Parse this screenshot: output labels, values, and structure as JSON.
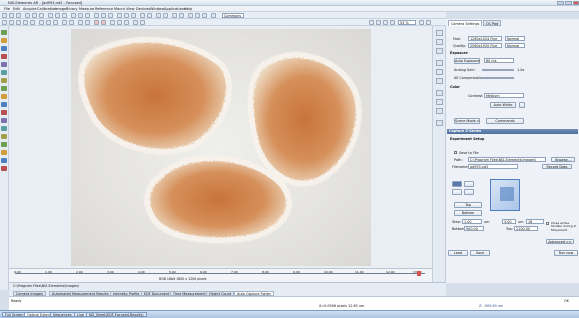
{
  "window": {
    "title": "NIS-Elements AR - [ad593.nd2 - Focused]"
  },
  "menu": [
    "File",
    "Edit",
    "Acquire",
    "Calibration",
    "Image",
    "Binary",
    "Measure",
    "Reference",
    "Macro",
    "View",
    "Devices",
    "Window",
    "Applications",
    "Help"
  ],
  "toolbar": {
    "zoom": "53 %",
    "lut_mode": "Commons"
  },
  "panel": {
    "tabs": [
      "Camera Settings",
      "OC Pad"
    ],
    "camera": {
      "fast_label": "Fast:",
      "fast_value": "1280x1024 Fine",
      "fast_mode": "Normal",
      "quality_label": "Quality:",
      "quality_value": "2560x1920 Fine",
      "quality_mode": "Normal",
      "exposure_heading": "Exposure",
      "auto_exposure_label": "Auto Exposure",
      "auto_exposure_value": "60 ms",
      "analog_gain_label": "Analog Gain",
      "analog_gain_value": "1.0x",
      "ae_comp_label": "AE Compensation",
      "color_heading": "Color",
      "contrast_label": "Contrast",
      "contrast_value": "Medium",
      "auto_white_label": "Auto White",
      "scene_mode_label": "Scene Mode >",
      "commands_label": "Commands"
    },
    "capture": {
      "header": "Capture Z-Series",
      "experiment_setup": "Experiment Setup",
      "save_to_file_label": "Save to File",
      "path_label": "Path:",
      "path_value": "C:\\Program Files\\NIS-Elements\\Images\\",
      "browse_label": "Browse...",
      "filename_label": "Filename:",
      "filename_value": "ad593.nd2",
      "record_data_label": "Record Data",
      "top_label": "Top",
      "bottom_label": "Bottom",
      "step_label": "Step:",
      "step_value": "1.00",
      "step_unit": "um",
      "step2_value": "3.00",
      "step2_unit": "um",
      "step3_value": "16",
      "bottom_field_label": "Bottom:",
      "bottom_value": "900.00",
      "top_field_label": "Top:",
      "top_value": "2100.00",
      "close_shutter_label": "Close active Shutter during Z Movement",
      "advanced_label": "Advanced >>",
      "load_label": "Load",
      "save_label": "Save",
      "run_now_label": "Run now"
    }
  },
  "bottom_tabs": [
    "Camera Images",
    "Automated Measurement Results",
    "Intensity Profile",
    "EDF Document",
    "Time Measurement",
    "Object Count",
    "Auto Capture Folder"
  ],
  "log": {
    "line1": "C:\\Program Files\\NIS-Elements\\Images\\",
    "status_ready": "Ready",
    "status_coords": "X=0.0956 pixels 12.65 um",
    "status_z": "Z: -900.90 um",
    "status_right": "OK",
    "status_bytes": "RGB 16bit 1600 x 1200 pixels"
  },
  "taskbar": {
    "tasks": [
      "Full Screen",
      "Optical Extended",
      "Sequences",
      "Live",
      "ND_Sheet(EDF-Focused-Results)"
    ]
  },
  "ruler": {
    "ticks": [
      "0.00",
      "1.00",
      "2.00",
      "3.00",
      "4.00",
      "5.00",
      "6.00",
      "7.00",
      "8.00",
      "9.00",
      "10.00",
      "11.00",
      "12.00",
      "13.00"
    ]
  }
}
